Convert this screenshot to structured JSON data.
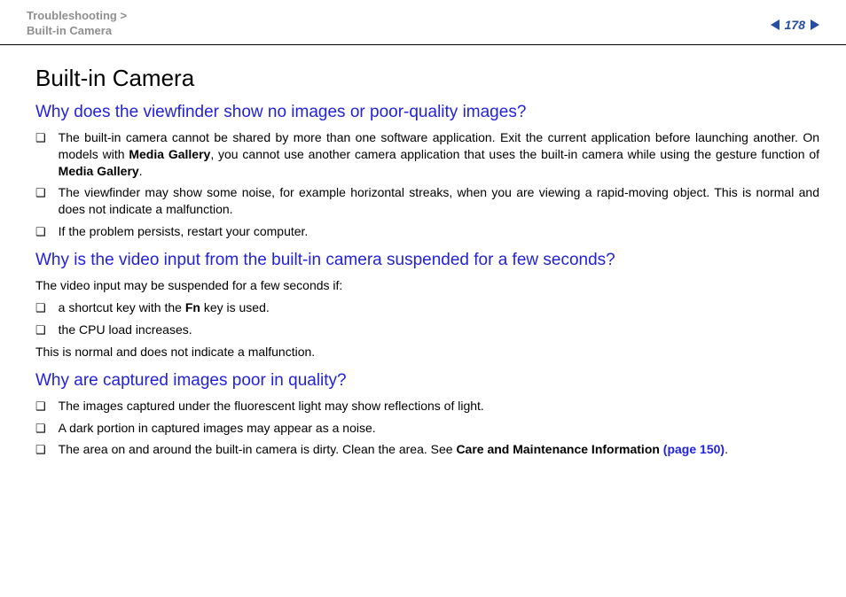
{
  "header": {
    "breadcrumb_section": "Troubleshooting",
    "breadcrumb_sep": ">",
    "breadcrumb_page": "Built-in Camera",
    "page_number": "178"
  },
  "main": {
    "title": "Built-in Camera",
    "q1": {
      "heading": "Why does the viewfinder show no images or poor-quality images?",
      "bullets": [
        {
          "pre": "The built-in camera cannot be shared by more than one software application. Exit the current application before launching another. On models with ",
          "b1": "Media Gallery",
          "mid": ", you cannot use another camera application that uses the built-in camera while using the gesture function of ",
          "b2": "Media Gallery",
          "post": "."
        },
        {
          "text": "The viewfinder may show some noise, for example horizontal streaks, when you are viewing a rapid-moving object. This is normal and does not indicate a malfunction."
        },
        {
          "text": "If the problem persists, restart your computer."
        }
      ]
    },
    "q2": {
      "heading": "Why is the video input from the built-in camera suspended for a few seconds?",
      "intro": "The video input may be suspended for a few seconds if:",
      "bullets": [
        {
          "pre": "a shortcut key with the ",
          "b": "Fn",
          "post": " key is used."
        },
        {
          "text": "the CPU load increases."
        }
      ],
      "outro": "This is normal and does not indicate a malfunction."
    },
    "q3": {
      "heading": "Why are captured images poor in quality?",
      "bullets": [
        {
          "text": "The images captured under the fluorescent light may show reflections of light."
        },
        {
          "text": "A dark portion in captured images may appear as a noise."
        },
        {
          "pre": "The area on and around the built-in camera is dirty. Clean the area. See ",
          "b": "Care and Maintenance Information",
          "link": " (page 150)",
          "post": "."
        }
      ]
    }
  }
}
